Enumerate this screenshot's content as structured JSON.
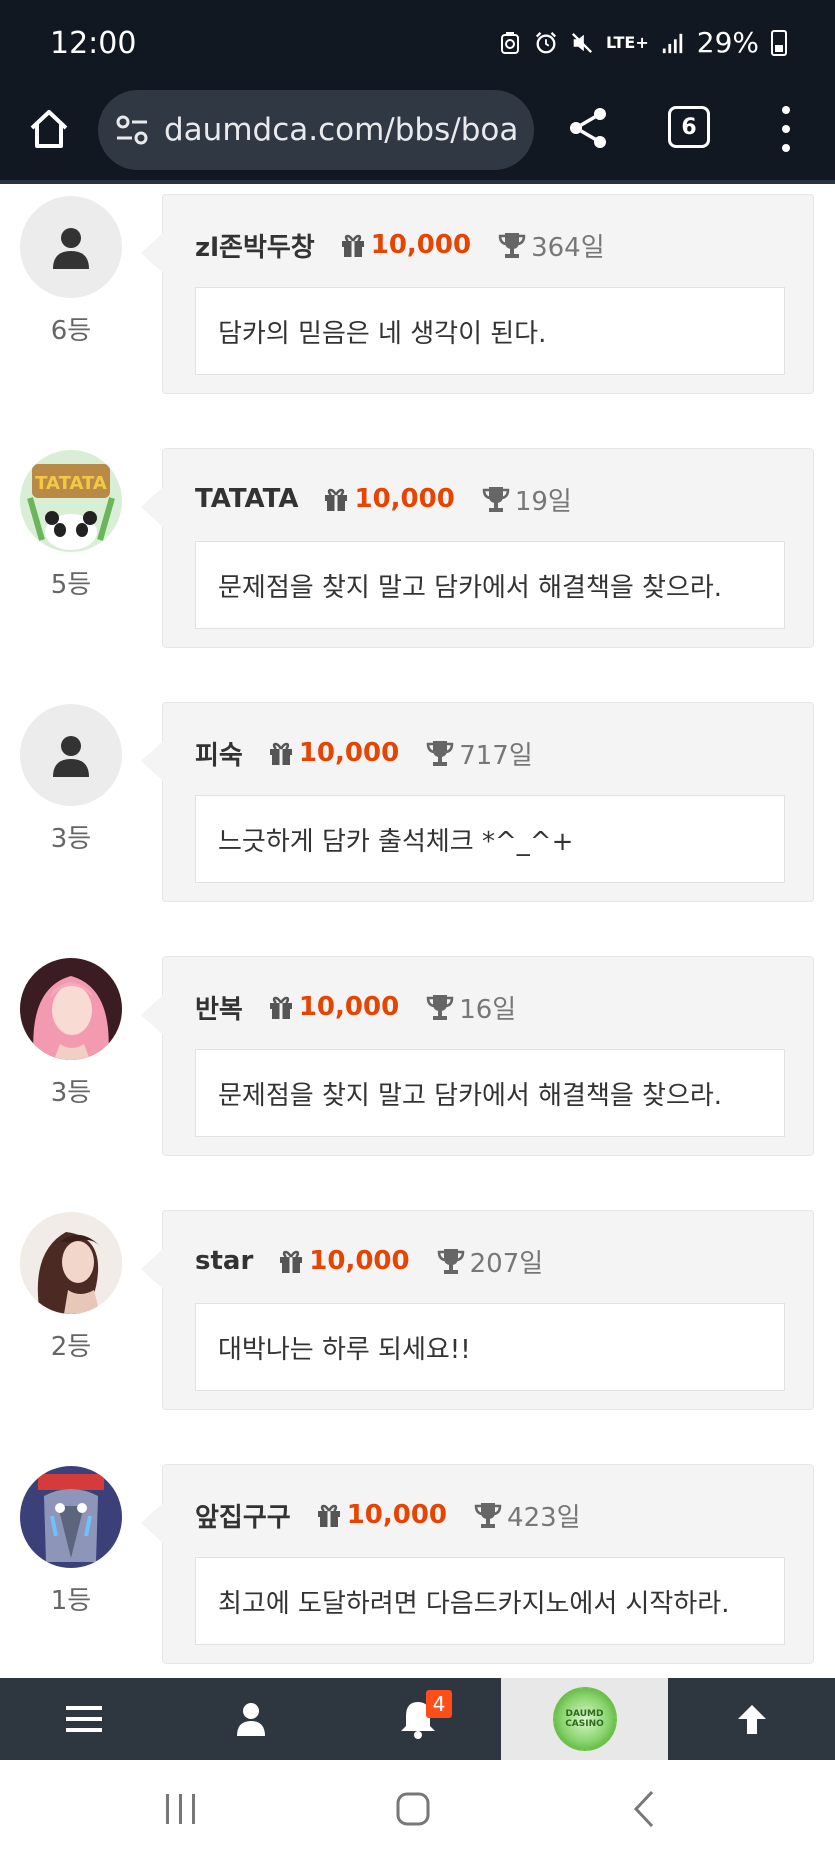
{
  "status_bar": {
    "time": "12:00",
    "network": "LTE+",
    "battery": "29%"
  },
  "browser": {
    "url": "daumdca.com/bbs/boa",
    "tab_count": "6"
  },
  "entries": [
    {
      "rank": "6등",
      "nickname": "zl존박두창",
      "points": "10,000",
      "days": "364일",
      "message": "담카의 믿음은 네 생각이 된다.",
      "avatar": "default"
    },
    {
      "rank": "5등",
      "nickname": "TATATA",
      "points": "10,000",
      "days": "19일",
      "message": "문제점을 찾지 말고 담카에서 해결책을 찾으라.",
      "avatar": "tatata"
    },
    {
      "rank": "3등",
      "nickname": "피숙",
      "points": "10,000",
      "days": "717일",
      "message": "느긋하게 담카 출석체크 *^_^+",
      "avatar": "default"
    },
    {
      "rank": "3등",
      "nickname": "반복",
      "points": "10,000",
      "days": "16일",
      "message": "문제점을 찾지 말고 담카에서 해결책을 찾으라.",
      "avatar": "pink-hair"
    },
    {
      "rank": "2등",
      "nickname": "star",
      "points": "10,000",
      "days": "207일",
      "message": "대박나는 하루 되세요!!",
      "avatar": "woman"
    },
    {
      "rank": "1등",
      "nickname": "앞집구구",
      "points": "10,000",
      "days": "423일",
      "message": "최고에 도달하려면 다음드카지노에서 시작하라.",
      "avatar": "cartoon"
    }
  ],
  "bottom_nav": {
    "notification_count": "4",
    "logo_text": "DAUMD CASINO"
  },
  "colors": {
    "points": "#e64400",
    "browser_bg": "#121821",
    "nav_bg": "#2e3640",
    "badge": "#ff4e1a"
  }
}
